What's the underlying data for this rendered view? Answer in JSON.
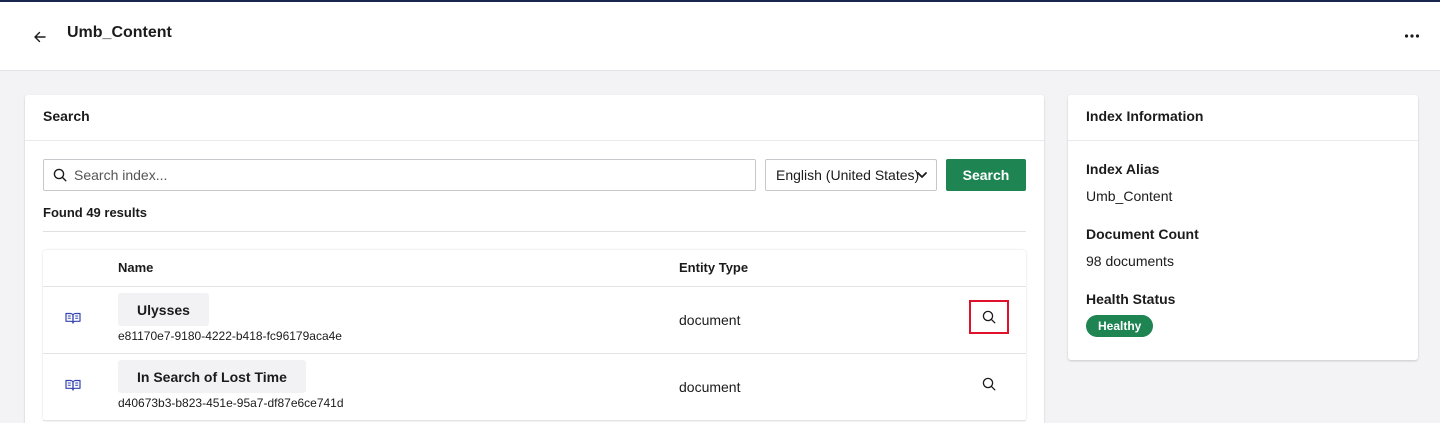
{
  "header": {
    "title": "Umb_Content"
  },
  "search_panel": {
    "title": "Search",
    "search_placeholder": "Search index...",
    "culture_selected": "English (United States)",
    "search_button_label": "Search",
    "results_count_text": "Found 49 results",
    "columns": [
      "Name",
      "Entity Type"
    ],
    "rows": [
      {
        "name": "Ulysses",
        "id": "e81170e7-9180-4222-b418-fc96179aca4e",
        "entity_type": "document"
      },
      {
        "name": "In Search of Lost Time",
        "id": "d40673b3-b823-451e-95a7-df87e6ce741d",
        "entity_type": "document"
      }
    ]
  },
  "info_panel": {
    "title": "Index Information",
    "alias_label": "Index Alias",
    "alias_value": "Umb_Content",
    "count_label": "Document Count",
    "count_value": "98 documents",
    "health_label": "Health Status",
    "health_value": "Healthy"
  },
  "colors": {
    "primary_green": "#1e8452",
    "navy": "#1b264f",
    "highlight_red": "#e0112b"
  },
  "icons": [
    "arrow-left-icon",
    "more-horizontal-icon",
    "search-icon",
    "chevron-down-icon",
    "book-open-icon"
  ]
}
